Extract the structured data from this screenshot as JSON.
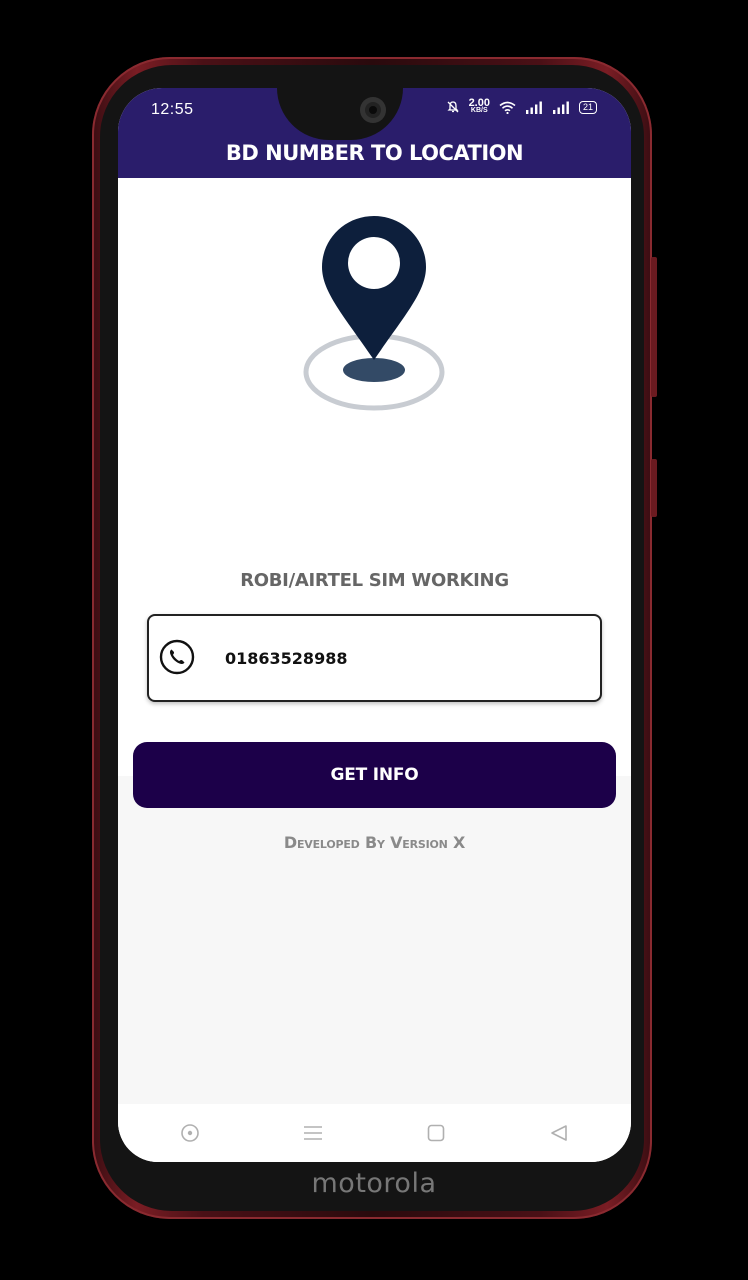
{
  "status_bar": {
    "time": "12:55",
    "net_speed_value": "2.00",
    "net_speed_unit": "KB/S",
    "battery": "21",
    "icons": [
      "mute-bell-icon",
      "wifi-icon",
      "signal-icon",
      "signal-icon",
      "battery-icon"
    ]
  },
  "appbar": {
    "title": "BD NUMBER TO LOCATION"
  },
  "main": {
    "illustration": "location-pin-icon",
    "sim_label": "ROBI/AIRTEL SIM WORKING",
    "phone_input": {
      "value": "01863528988",
      "icon": "phone-icon"
    },
    "get_info_label": "GET INFO",
    "credit": "Developed By Version X"
  },
  "nav": {
    "items": [
      "assistant-icon",
      "menu-icon",
      "home-square-icon",
      "back-triangle-icon"
    ]
  },
  "device": {
    "brand": "motorola"
  },
  "colors": {
    "primary": "#2a1d6b",
    "button": "#1c0049",
    "pin": "#0d1f3c"
  }
}
